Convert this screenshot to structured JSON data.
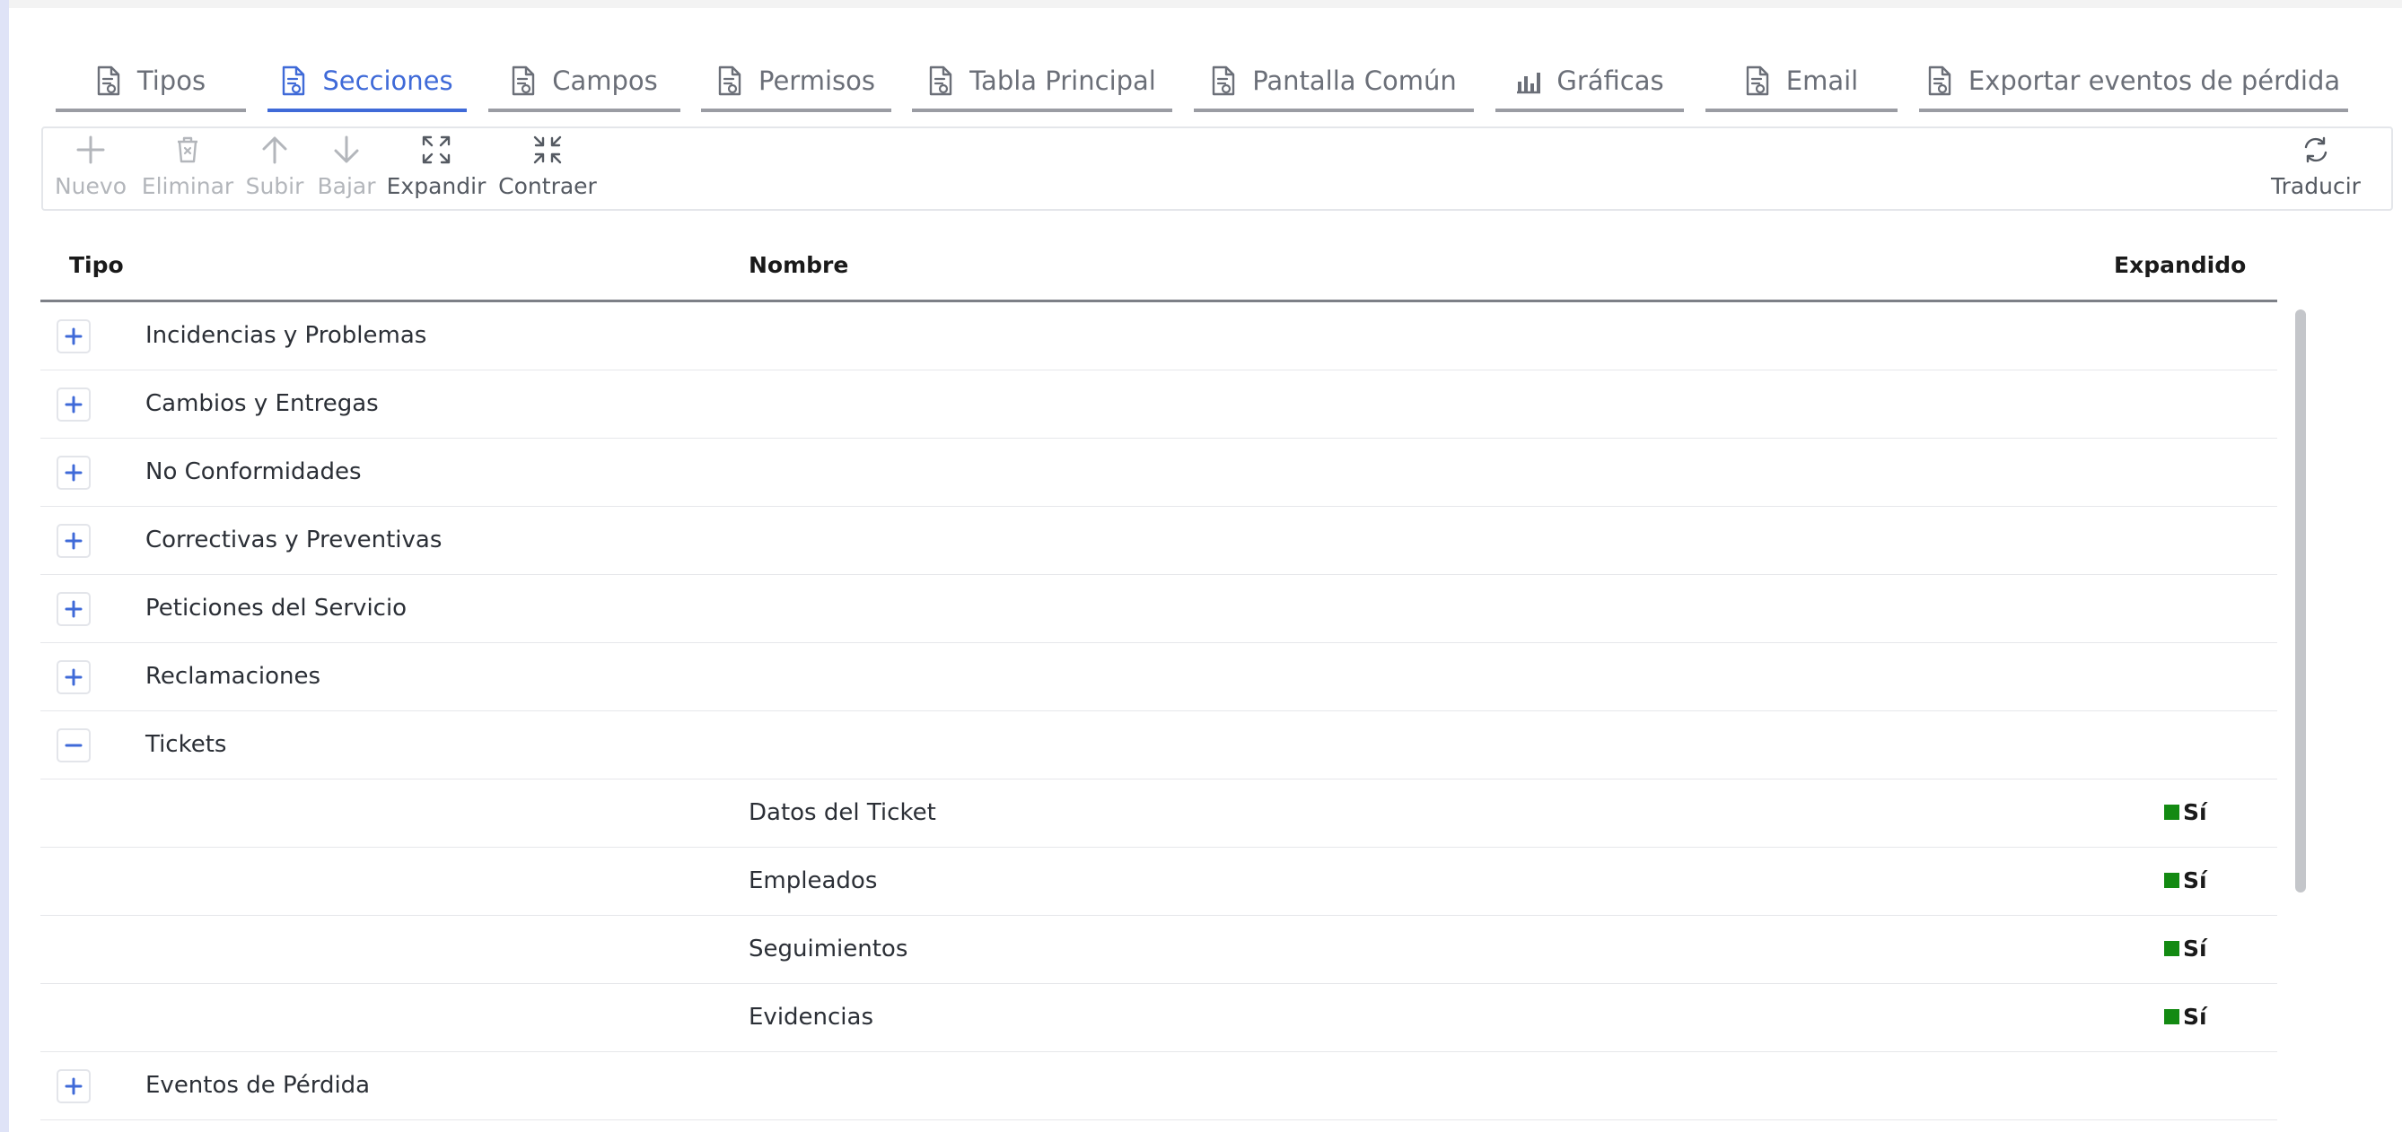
{
  "tabs": [
    {
      "label": "Tipos",
      "icon": "document-icon",
      "active": false
    },
    {
      "label": "Secciones",
      "icon": "document-icon",
      "active": true
    },
    {
      "label": "Campos",
      "icon": "document-icon",
      "active": false
    },
    {
      "label": "Permisos",
      "icon": "document-icon",
      "active": false
    },
    {
      "label": "Tabla Principal",
      "icon": "document-icon",
      "active": false
    },
    {
      "label": "Pantalla Común",
      "icon": "document-icon",
      "active": false
    },
    {
      "label": "Gráficas",
      "icon": "bar-chart-icon",
      "active": false
    },
    {
      "label": "Email",
      "icon": "document-icon",
      "active": false
    },
    {
      "label": "Exportar eventos de pérdida",
      "icon": "document-icon",
      "active": false
    }
  ],
  "toolbar": {
    "nuevo": "Nuevo",
    "eliminar": "Eliminar",
    "subir": "Subir",
    "bajar": "Bajar",
    "expandir": "Expandir",
    "contraer": "Contraer",
    "traducir": "Traducir"
  },
  "table": {
    "headers": {
      "tipo": "Tipo",
      "nombre": "Nombre",
      "expandido": "Expandido"
    },
    "groups": [
      {
        "label": "Incidencias y Problemas",
        "expanded": false
      },
      {
        "label": "Cambios y Entregas",
        "expanded": false
      },
      {
        "label": "No Conformidades",
        "expanded": false
      },
      {
        "label": "Correctivas y Preventivas",
        "expanded": false
      },
      {
        "label": "Peticiones del Servicio",
        "expanded": false
      },
      {
        "label": "Reclamaciones",
        "expanded": false
      },
      {
        "label": "Tickets",
        "expanded": true
      },
      {
        "label": "Eventos de Pérdida",
        "expanded": false
      }
    ],
    "tickets_children": [
      {
        "nombre": "Datos del Ticket",
        "expandido": "Sí"
      },
      {
        "nombre": "Empleados",
        "expandido": "Sí"
      },
      {
        "nombre": "Seguimientos",
        "expandido": "Sí"
      },
      {
        "nombre": "Evidencias",
        "expandido": "Sí"
      }
    ]
  },
  "colors": {
    "accent": "#3f6ad8",
    "tab_inactive": "#6b6f78",
    "disabled": "#b3b6bb",
    "expanded_indicator": "#138a12"
  }
}
